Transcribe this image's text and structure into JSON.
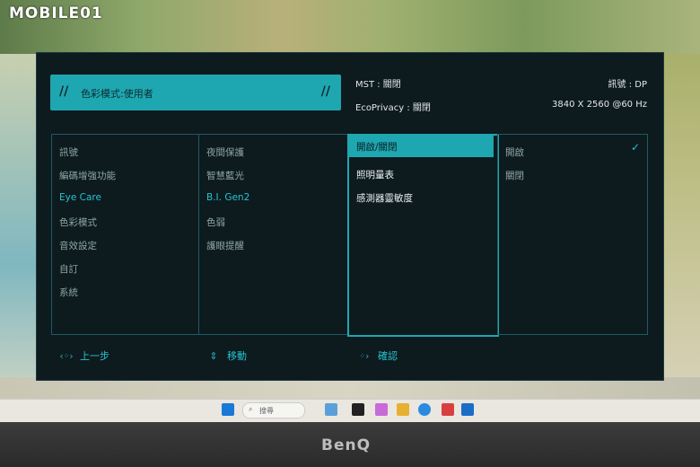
{
  "site_logo": "MOBILE01",
  "monitor_brand": "BenQ",
  "osd": {
    "mode": "色彩模式:使用者",
    "mst": "MST : 關閉",
    "signal": "訊號 : DP",
    "ecoprivacy": "EcoPrivacy : 關閉",
    "resolution": "3840 X 2560 @60 Hz",
    "menu_main": [
      "訊號",
      "編碼增強功能",
      "Eye Care",
      "色彩模式",
      "音效設定",
      "自訂",
      "系統"
    ],
    "menu_eye_care": [
      "夜間保護",
      "智慧藍光",
      "B.I. Gen2",
      "色弱",
      "護眼提醒"
    ],
    "menu_bi_gen2": [
      "開啟/關閉",
      "照明量表",
      "感測器靈敏度"
    ],
    "menu_options": [
      "開啟",
      "關閉"
    ],
    "footer": {
      "back": "上一步",
      "move": "移動",
      "confirm": "確認"
    }
  },
  "taskbar": {
    "search_placeholder": "搜尋"
  },
  "colors": {
    "accent": "#1ea7b0",
    "osd_bg": "#0d1a1e"
  }
}
